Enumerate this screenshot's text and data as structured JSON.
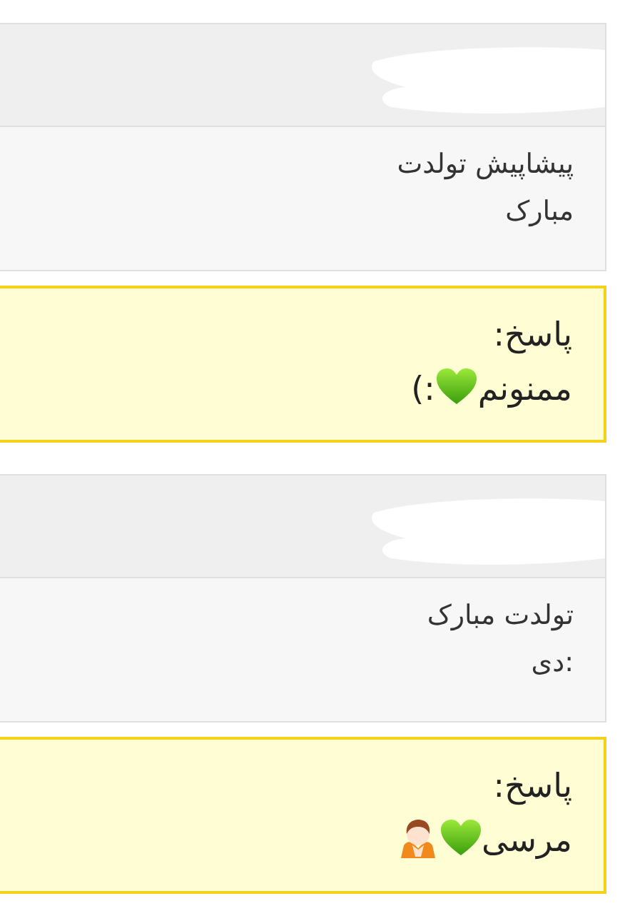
{
  "comments": [
    {
      "body_lines": [
        "پیشاپیش تولدت",
        "مبارک"
      ],
      "reply": {
        "label": "پاسخ:",
        "parts": [
          {
            "kind": "text",
            "text": "ممنونم"
          },
          {
            "kind": "heart"
          },
          {
            "kind": "text",
            "text": ":)"
          }
        ]
      }
    },
    {
      "body_lines": [
        "تولدت مبارک",
        ":دی"
      ],
      "reply": {
        "label": "پاسخ:",
        "parts": [
          {
            "kind": "text",
            "text": "مرسی"
          },
          {
            "kind": "heart"
          },
          {
            "kind": "person"
          }
        ]
      }
    }
  ]
}
